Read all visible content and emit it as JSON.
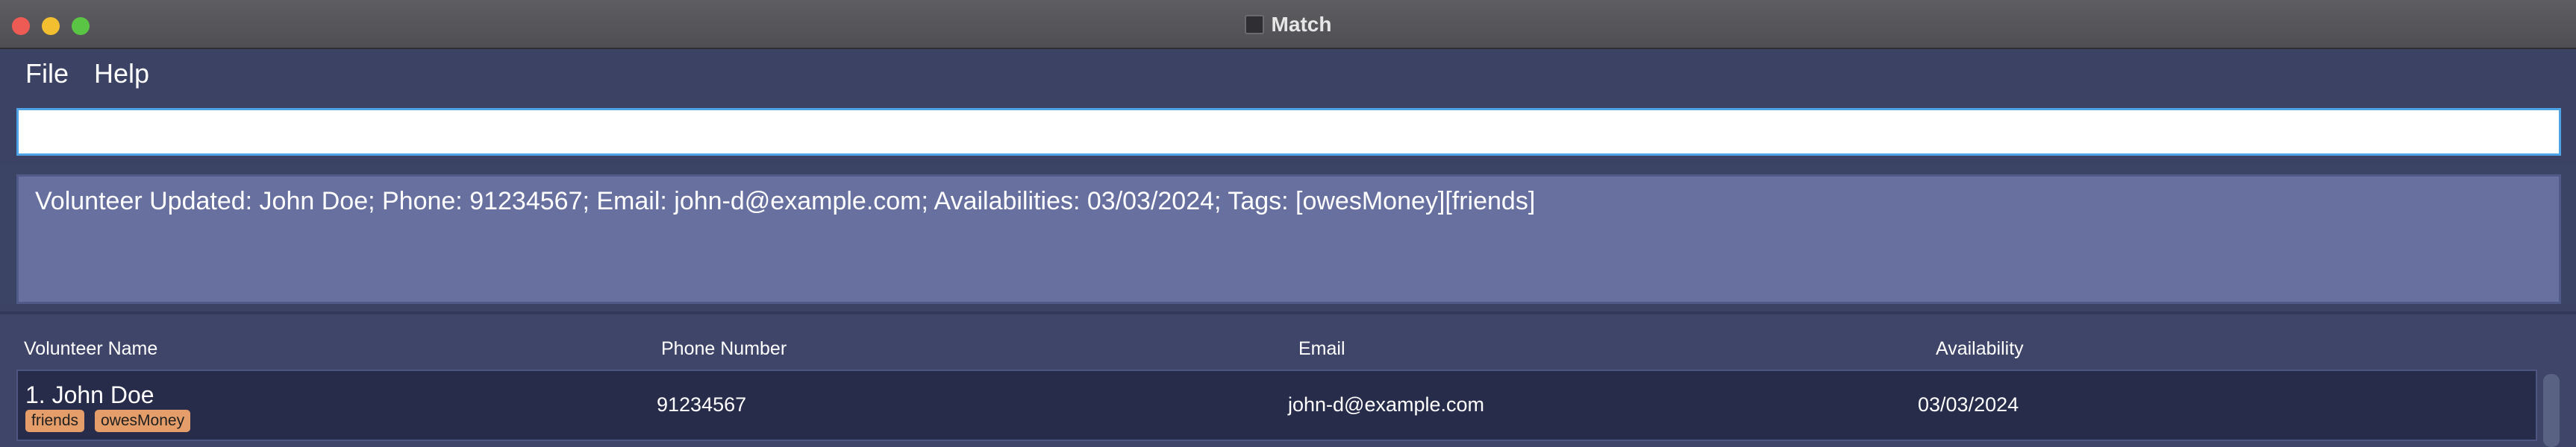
{
  "window": {
    "title": "Match"
  },
  "menu": {
    "items": [
      {
        "label": "File"
      },
      {
        "label": "Help"
      }
    ]
  },
  "command": {
    "value": "",
    "placeholder": ""
  },
  "result": {
    "message": "Volunteer Updated: John Doe; Phone: 91234567; Email: john-d@example.com; Availabilities: 03/03/2024; Tags: [owesMoney][friends]"
  },
  "table": {
    "headers": {
      "name": "Volunteer Name",
      "phone": "Phone Number",
      "email": "Email",
      "availability": "Availability"
    },
    "rows": [
      {
        "name": "1. John Doe",
        "tags": [
          "friends",
          "owesMoney"
        ],
        "phone": "91234567",
        "email": "john-d@example.com",
        "availability": "03/03/2024"
      }
    ]
  },
  "colors": {
    "background": "#3c4466",
    "result_box": "#67709f",
    "row_background": "#272c4a",
    "tag": "#e59e69"
  }
}
